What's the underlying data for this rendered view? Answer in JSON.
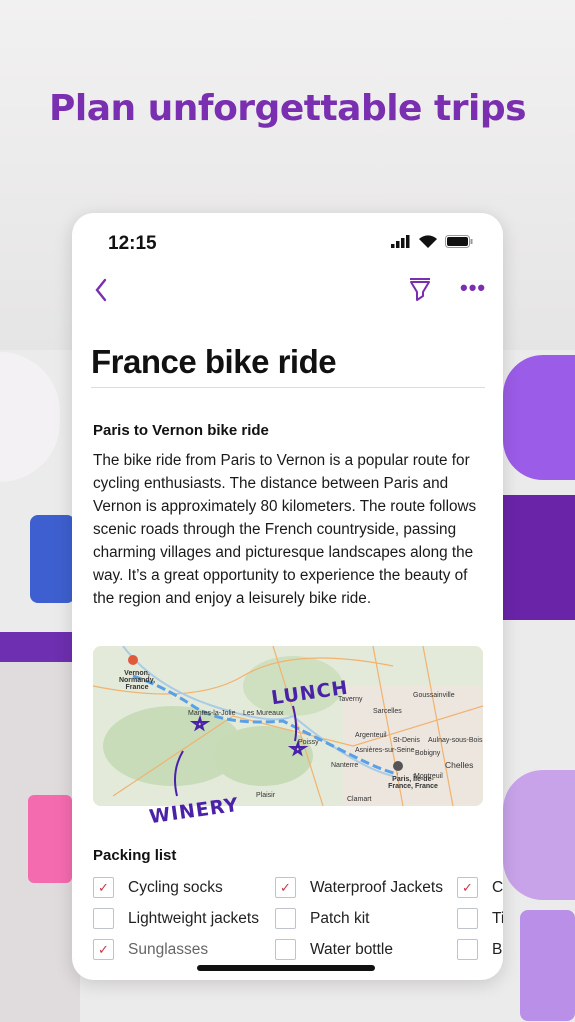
{
  "headline": "Plan unforgettable trips",
  "status_bar": {
    "time": "12:15"
  },
  "toolbar": {
    "back_icon": "chevron-left-icon",
    "pen_icon": "highlighter-icon",
    "more_icon": "more-horizontal-icon"
  },
  "page": {
    "title": "France bike ride",
    "subtitle": "Paris to Vernon bike ride",
    "paragraph": "The bike ride from Paris to Vernon is a popular route for cycling enthusiasts. The distance between Paris and Vernon is approximately 80 kilometers. The route follows scenic roads through the French countryside, passing charming villages and picturesque landscapes along the way. It’s a great opportunity to experience the beauty of the region and enjoy a leisurely bike ride."
  },
  "map": {
    "labels": {
      "vernon": "Vernon, Normandy, France",
      "paris": "Paris, Île-de-France, France",
      "mantes": "Mantes-la-Jolie",
      "mureaux": "Les Mureaux",
      "poissy": "Poissy",
      "taverny": "Taverny",
      "sarcelles": "Sarcelles",
      "goussainville": "Goussainville",
      "argenteuil": "Argenteuil",
      "stdenis": "St-Denis",
      "aulnay": "Aulnay-sous-Bois",
      "asnieres": "Asnières-sur-Seine",
      "bobigny": "Bobigny",
      "nanterre": "Nanterre",
      "montreuil": "Montreuil",
      "chelles": "Chelles",
      "plaisir": "Plaisir",
      "clamart": "Clamart"
    },
    "annotations": {
      "lunch": "LUNCH",
      "winery": "WINERY"
    },
    "colors": {
      "route": "#5aa0e6",
      "ink": "#4a22a8"
    }
  },
  "packing": {
    "title": "Packing list",
    "items": [
      {
        "label": "Cycling socks",
        "checked": true
      },
      {
        "label": "Waterproof Jackets",
        "checked": true
      },
      {
        "label": "Cy",
        "checked": true
      },
      {
        "label": "Lightweight jackets",
        "checked": false
      },
      {
        "label": "Patch kit",
        "checked": false
      },
      {
        "label": "Ti",
        "checked": false
      },
      {
        "label": "Sunglasses",
        "checked": true
      },
      {
        "label": "Water bottle",
        "checked": false
      },
      {
        "label": "Bi",
        "checked": false
      }
    ]
  },
  "colors": {
    "accent": "#7a2fb0",
    "check": "#c8384a"
  }
}
